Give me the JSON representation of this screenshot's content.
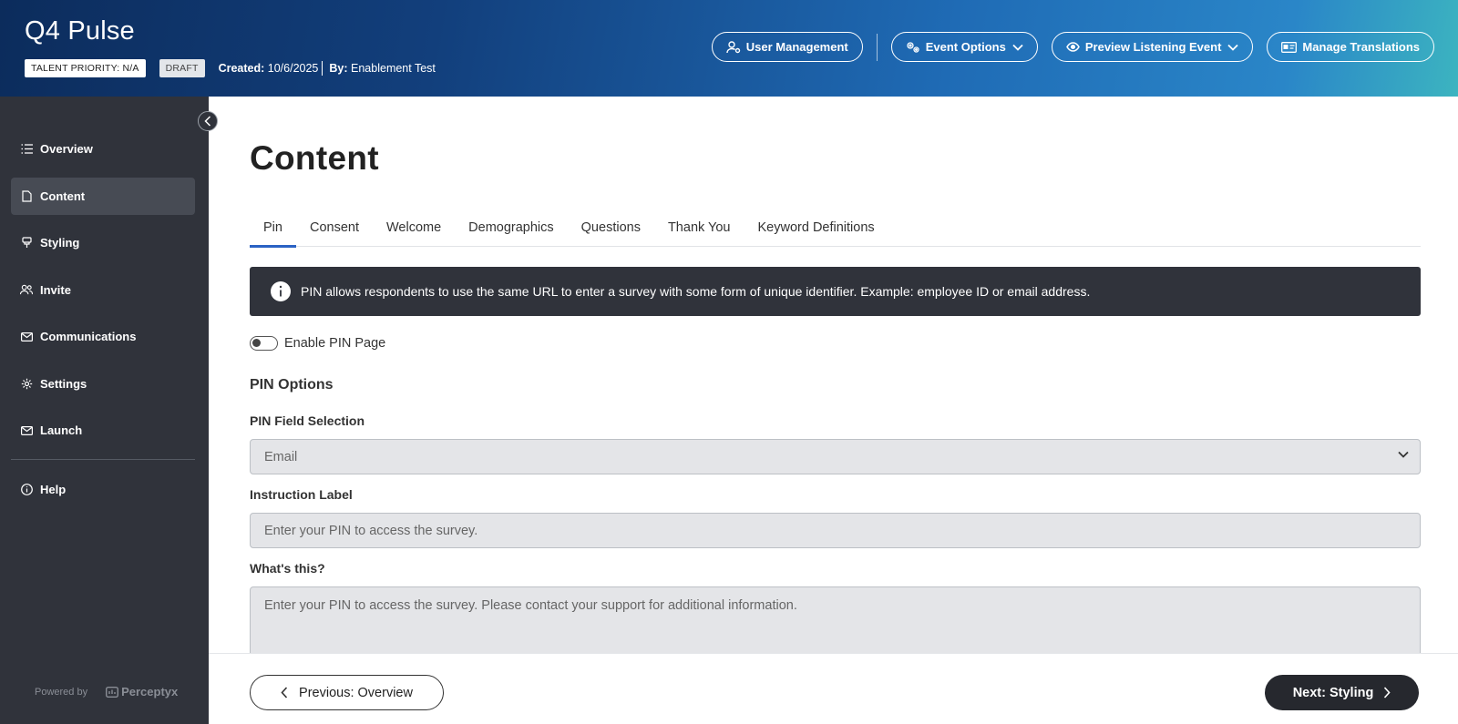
{
  "header": {
    "app_title": "Q4 Pulse",
    "talent_priority": "TALENT PRIORITY: N/A",
    "status": "DRAFT",
    "created_label": "Created:",
    "created_value": "10/6/2025",
    "by_label": "By:",
    "by_value": "Enablement Test",
    "actions": {
      "user_management": "User Management",
      "event_options": "Event Options",
      "preview": "Preview Listening Event",
      "translations": "Manage Translations"
    }
  },
  "sidebar": {
    "items": [
      {
        "label": "Overview",
        "icon": "list-icon"
      },
      {
        "label": "Content",
        "icon": "document-icon",
        "active": true
      },
      {
        "label": "Styling",
        "icon": "paintbrush-icon"
      },
      {
        "label": "Invite",
        "icon": "users-icon"
      },
      {
        "label": "Communications",
        "icon": "mail-icon"
      },
      {
        "label": "Settings",
        "icon": "gear-icon"
      },
      {
        "label": "Launch",
        "icon": "launch-mail-icon"
      }
    ],
    "help": "Help",
    "powered_by": "Powered by",
    "brand": "Perceptyx"
  },
  "main": {
    "page_title": "Content",
    "tabs": [
      "Pin",
      "Consent",
      "Welcome",
      "Demographics",
      "Questions",
      "Thank You",
      "Keyword Definitions"
    ],
    "active_tab": "Pin",
    "info_banner": "PIN allows respondents to use the same URL to enter a survey with some form of unique identifier. Example: employee ID or email address.",
    "enable_pin_label": "Enable PIN Page",
    "enable_pin_value": false,
    "pin_options_title": "PIN Options",
    "pin_field_label": "PIN Field Selection",
    "pin_field_value": "Email",
    "instruction_label": "Instruction Label",
    "instruction_placeholder": "Enter your PIN to access the survey.",
    "whats_this_label": "What's this?",
    "whats_this_placeholder": "Enter your PIN to access the survey. Please contact your support for additional information."
  },
  "footer": {
    "previous": "Previous: Overview",
    "next": "Next: Styling"
  },
  "colors": {
    "sidebar_bg": "#30333b",
    "accent_tab": "#2b62c4",
    "banner_bg": "#30333b",
    "next_button_bg": "#26282e"
  }
}
